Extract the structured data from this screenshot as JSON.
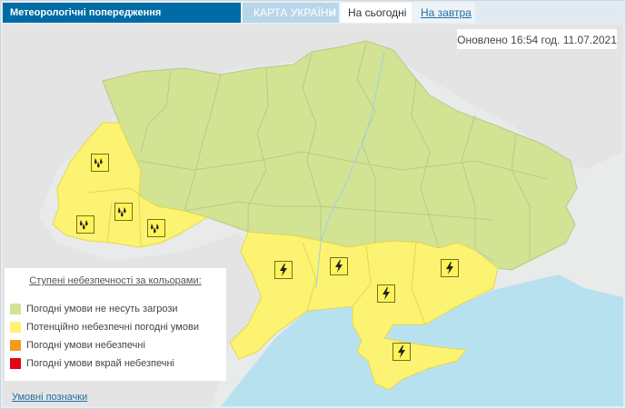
{
  "header": {
    "title": "Метеорологічні попередження",
    "tab_map": "КАРТА УКРАЇНИ",
    "tab_today": "На сьогодні",
    "tab_tomorrow": "На завтра"
  },
  "updated_text": "Оновлено 16:54 год. 11.07.2021",
  "legend": {
    "title": "Ступені небезпечності за кольорами:",
    "items": [
      {
        "label": "Погодні умови не несуть загрози",
        "color": "#d3e394"
      },
      {
        "label": "Потенційно небезпечні погодні умови",
        "color": "#fdf372"
      },
      {
        "label": "Погодні умови небезпечні",
        "color": "#f39b1d"
      },
      {
        "label": "Погодні умови вкрай небезпечні",
        "color": "#e30613"
      }
    ]
  },
  "symbols_link": "Умовні позначки",
  "colors": {
    "header_blue": "#006ca5",
    "sea": "#b8e1f0",
    "no_threat": "#d3e394",
    "potential": "#fdf372"
  },
  "icons": {
    "rain": "rain-drops-icon",
    "thunder": "lightning-icon"
  }
}
